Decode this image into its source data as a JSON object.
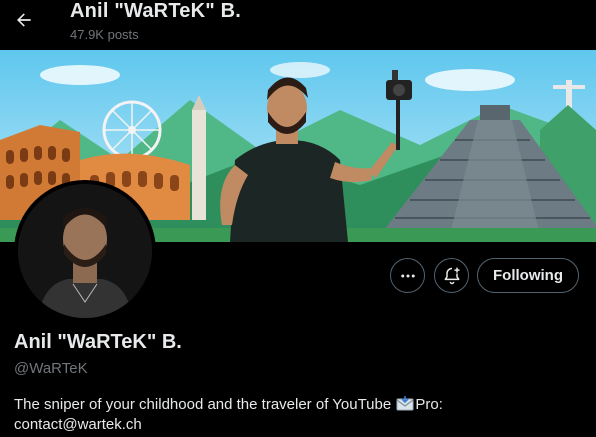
{
  "header": {
    "title": "Anil \"WaRTeK\" B.",
    "posts_count": "47.9K posts"
  },
  "profile": {
    "name": "Anil \"WaRTeK\" B.",
    "handle": "@WaRTeK",
    "bio_prefix": "The sniper of your childhood and the traveler of YouTube ",
    "bio_suffix": "Pro:",
    "bio_contact": "contact@wartek.ch"
  },
  "actions": {
    "more": "more-icon",
    "notify": "bell-plus-icon",
    "follow_label": "Following"
  },
  "colors": {
    "background": "#000000",
    "text_primary": "#e7e9ea",
    "text_secondary": "#71767b",
    "button_border": "#536471"
  }
}
